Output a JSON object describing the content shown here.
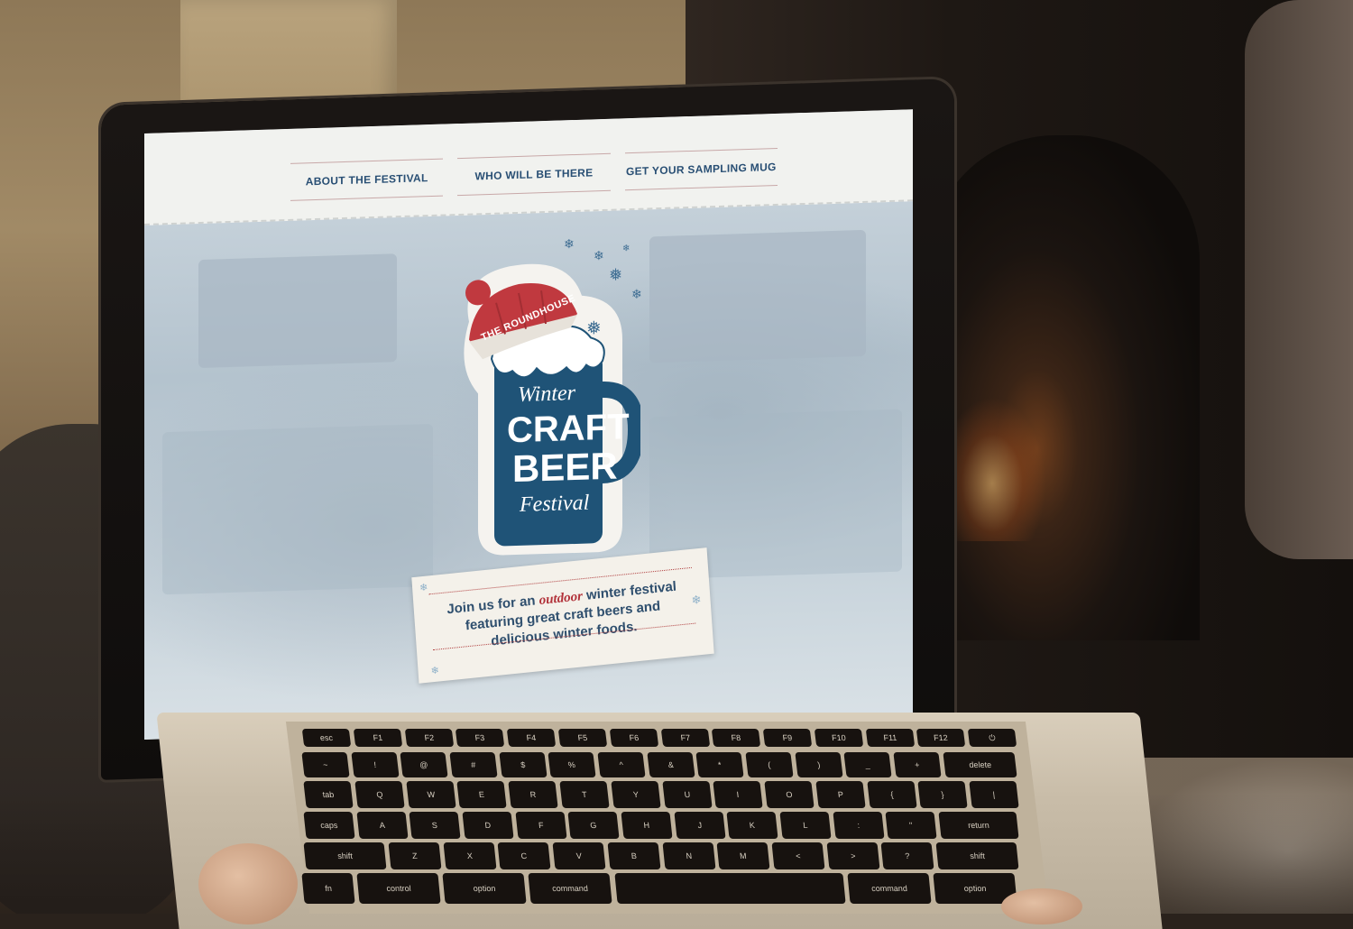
{
  "nav": {
    "items": [
      {
        "label": "ABOUT THE FESTIVAL"
      },
      {
        "label": "WHO WILL BE THERE"
      },
      {
        "label": "GET YOUR SAMPLING MUG"
      }
    ]
  },
  "logo": {
    "arch_text": "THE ROUNDHOUSE",
    "line1": "Winter",
    "line2": "CRAFT",
    "line3": "BEER",
    "line4": "Festival"
  },
  "tagline": {
    "part1": "Join us for an",
    "emphasis": "outdoor",
    "part2": "winter festival featuring great craft beers and delicious winter foods."
  },
  "keyboard": {
    "row1": [
      "esc",
      "F1",
      "F2",
      "F3",
      "F4",
      "F5",
      "F6",
      "F7",
      "F8",
      "F9",
      "F10",
      "F11",
      "F12",
      "⏻"
    ],
    "row2": [
      "~",
      "!",
      "@",
      "#",
      "$",
      "%",
      "^",
      "&",
      "*",
      "(",
      ")",
      "_",
      "+",
      "delete"
    ],
    "row3": [
      "tab",
      "Q",
      "W",
      "E",
      "R",
      "T",
      "Y",
      "U",
      "I",
      "O",
      "P",
      "{",
      "}",
      "|"
    ],
    "row4": [
      "caps",
      "A",
      "S",
      "D",
      "F",
      "G",
      "H",
      "J",
      "K",
      "L",
      ":",
      "\"",
      "return"
    ],
    "row5": [
      "shift",
      "Z",
      "X",
      "C",
      "V",
      "B",
      "N",
      "M",
      "<",
      ">",
      "?",
      "shift"
    ],
    "row6": [
      "fn",
      "control",
      "option",
      "command",
      "",
      "command",
      "option"
    ]
  },
  "colors": {
    "navy": "#294f74",
    "mug_blue": "#1f5377",
    "hat_red": "#c0393f",
    "tag_red": "#b2323a"
  }
}
